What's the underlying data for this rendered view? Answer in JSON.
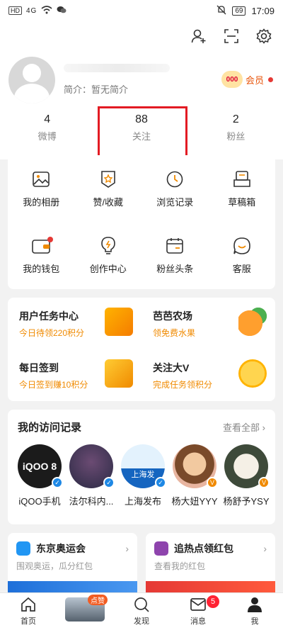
{
  "status_bar": {
    "network": "HD",
    "signal": "4G",
    "battery": "69",
    "time": "17:09"
  },
  "profile": {
    "bio": "简介：暂无简介",
    "member_label": "会员",
    "member_badge": "000"
  },
  "stats": [
    {
      "count": "4",
      "label": "微博"
    },
    {
      "count": "88",
      "label": "关注"
    },
    {
      "count": "2",
      "label": "粉丝"
    }
  ],
  "menu": [
    {
      "label": "我的相册"
    },
    {
      "label": "赞/收藏"
    },
    {
      "label": "浏览记录"
    },
    {
      "label": "草稿箱"
    },
    {
      "label": "我的钱包"
    },
    {
      "label": "创作中心"
    },
    {
      "label": "粉丝头条"
    },
    {
      "label": "客服"
    }
  ],
  "tasks": [
    {
      "title": "用户任务中心",
      "subtitle": "今日待领220积分"
    },
    {
      "title": "芭芭农场",
      "subtitle": "领免费水果"
    },
    {
      "title": "每日签到",
      "subtitle": "今日签到赚10积分"
    },
    {
      "title": "关注大V",
      "subtitle": "完成任务领积分"
    }
  ],
  "visits": {
    "title": "我的访问记录",
    "more": "查看全部",
    "people": [
      {
        "name": "iQOO手机",
        "avatar_text": "iQOO 8"
      },
      {
        "name": "法尔科内..."
      },
      {
        "name": "上海发布",
        "avatar_text": "上海发"
      },
      {
        "name": "杨大妞YYY"
      },
      {
        "name": "杨舒予YSY"
      }
    ]
  },
  "promos": [
    {
      "title": "东京奥运会",
      "subtitle": "围观奥运，瓜分红包"
    },
    {
      "title": "追热点领红包",
      "subtitle": "查看我的红包"
    }
  ],
  "tabs": [
    {
      "label": "首页"
    },
    {
      "label": "发现",
      "badge": "点赞"
    },
    {
      "label": "发现"
    },
    {
      "label": "消息",
      "badge": "5"
    },
    {
      "label": "我"
    }
  ],
  "colors": {
    "accent": "#f08a00",
    "highlight": "#e31b23",
    "badge_red": "#e53935"
  }
}
